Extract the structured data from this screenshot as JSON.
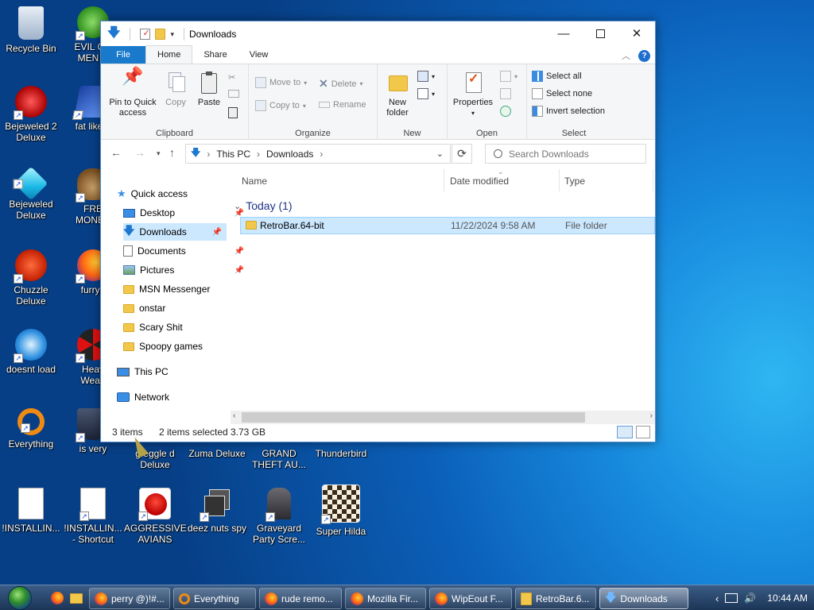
{
  "desktop": {
    "icons": [
      {
        "label": "Recycle Bin"
      },
      {
        "label": "EVIL GR\nMEN C"
      },
      {
        "label": "Bejeweled 2\nDeluxe"
      },
      {
        "label": "fat like d"
      },
      {
        "label": "Bejeweled\nDeluxe"
      },
      {
        "label": "FRE\nMONEY"
      },
      {
        "label": "Chuzzle\nDeluxe"
      },
      {
        "label": "furryp"
      },
      {
        "label": "doesnt load"
      },
      {
        "label": "Heav\nWeap"
      },
      {
        "label": "Everything"
      },
      {
        "label": "is very"
      },
      {
        "label": "g  eggle d\nDeluxe"
      },
      {
        "label": "Zuma Deluxe"
      },
      {
        "label": "GRAND\nTHEFT AU..."
      },
      {
        "label": "Thunderbird"
      },
      {
        "label": "!INSTALLIN..."
      },
      {
        "label": "!INSTALLIN...\n- Shortcut"
      },
      {
        "label": "AGGRESSIVE\nAVIANS"
      },
      {
        "label": "deez nuts spy"
      },
      {
        "label": "Graveyard\nParty Scre..."
      },
      {
        "label": "Super Hilda"
      }
    ]
  },
  "window": {
    "title": "Downloads",
    "tabs": {
      "file": "File",
      "home": "Home",
      "share": "Share",
      "view": "View"
    },
    "help": "?",
    "ribbon": {
      "clipboard": {
        "name": "Clipboard",
        "pin": "Pin to Quick\naccess",
        "copy": "Copy",
        "paste": "Paste"
      },
      "organize": {
        "name": "Organize",
        "move_to": "Move to",
        "copy_to": "Copy to",
        "delete": "Delete",
        "rename": "Rename"
      },
      "new": {
        "name": "New",
        "new_folder": "New\nfolder"
      },
      "open": {
        "name": "Open",
        "properties": "Properties"
      },
      "select": {
        "name": "Select",
        "select_all": "Select all",
        "select_none": "Select none",
        "invert": "Invert selection"
      }
    },
    "address": {
      "segments": [
        "This PC",
        "Downloads"
      ],
      "search_placeholder": "Search Downloads"
    },
    "nav": {
      "quick_access": "Quick access",
      "items": [
        {
          "label": "Desktop",
          "pinned": true
        },
        {
          "label": "Downloads",
          "pinned": true
        },
        {
          "label": "Documents",
          "pinned": true
        },
        {
          "label": "Pictures",
          "pinned": true
        },
        {
          "label": "MSN Messenger",
          "pinned": false
        },
        {
          "label": "onstar",
          "pinned": false
        },
        {
          "label": "Scary Shit",
          "pinned": false
        },
        {
          "label": "Spoopy games",
          "pinned": false
        }
      ],
      "this_pc": "This PC",
      "network": "Network"
    },
    "columns": {
      "name": "Name",
      "date": "Date modified",
      "type": "Type"
    },
    "group": "Today (1)",
    "files": [
      {
        "name": "RetroBar.64-bit",
        "date": "11/22/2024 9:58 AM",
        "type": "File folder"
      }
    ],
    "status": {
      "items": "3 items",
      "selected": "2 items selected",
      "size": "3.73 GB"
    }
  },
  "taskbar": {
    "buttons": [
      {
        "label": "perry @)!#...",
        "icon": "firefox-icon"
      },
      {
        "label": "Everything",
        "icon": "everything-icon"
      },
      {
        "label": "rude remo...",
        "icon": "firefox-icon"
      },
      {
        "label": "Mozilla Fir...",
        "icon": "firefox-icon"
      },
      {
        "label": "WipEout F...",
        "icon": "firefox-icon"
      },
      {
        "label": "RetroBar.6...",
        "icon": "folder-icon"
      },
      {
        "label": "Downloads",
        "icon": "downloads-icon"
      }
    ],
    "clock": "10:44 AM"
  }
}
